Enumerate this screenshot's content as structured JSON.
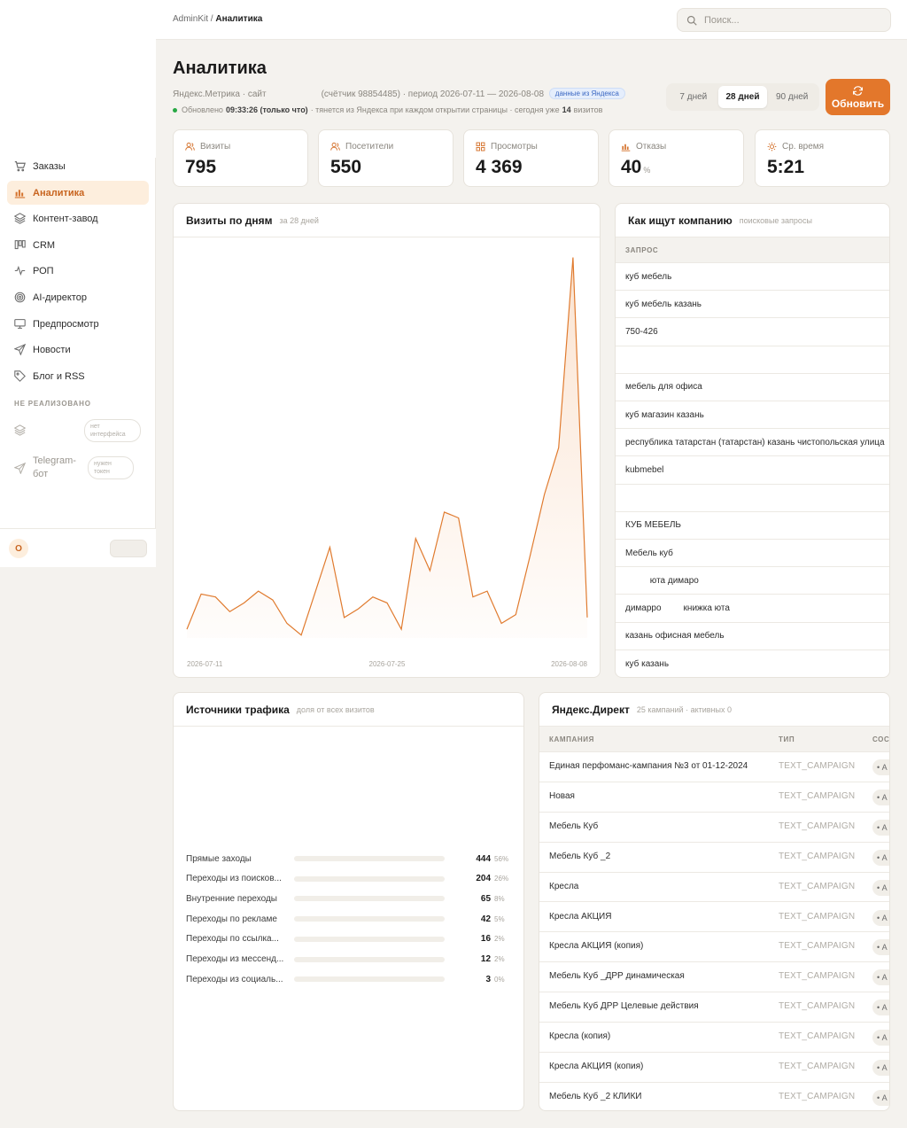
{
  "breadcrumb": {
    "root": "AdminKit",
    "separator": " / ",
    "current": "Аналитика"
  },
  "search": {
    "placeholder": "Поиск..."
  },
  "sidebar": {
    "items": [
      {
        "label": "Заказы",
        "icon": "cart-icon",
        "active": false
      },
      {
        "label": "Аналитика",
        "icon": "bar-chart-icon",
        "active": true
      },
      {
        "label": "Контент-завод",
        "icon": "layers-icon",
        "active": false
      },
      {
        "label": "CRM",
        "icon": "kanban-icon",
        "active": false
      },
      {
        "label": "РОП",
        "icon": "activity-icon",
        "active": false
      },
      {
        "label": "AI-директор",
        "icon": "target-icon",
        "active": false
      },
      {
        "label": "Предпросмотр",
        "icon": "monitor-icon",
        "active": false
      },
      {
        "label": "Новости",
        "icon": "send-icon",
        "active": false
      },
      {
        "label": "Блог и RSS",
        "icon": "tag-icon",
        "active": false
      }
    ],
    "section_label": "НЕ РЕАЛИЗОВАНО",
    "disabled": [
      {
        "label": "",
        "note": "нет интерфейса",
        "icon": "layers-icon"
      },
      {
        "label": "Telegram-бот",
        "note": "нужен токен",
        "icon": "send-icon"
      }
    ],
    "avatar_initial": "О"
  },
  "header": {
    "title": "Аналитика",
    "source": "Яндекс.Метрика · сайт",
    "counter": "(счётчик 98854485) · период 2026-07-11 — 2026-08-08",
    "badge": "данные из Яндекса",
    "updated_prefix": "Обновлено",
    "updated_time": "09:33:26 (только что)",
    "updated_suffix": "· тянется из Яндекса при каждом открытии страницы · сегодня уже",
    "today_visits": "14",
    "today_visits_unit": "визитов",
    "ranges": [
      "7 дней",
      "28 дней",
      "90 дней"
    ],
    "selected_range": "28 дней",
    "refresh_label": "Обновить"
  },
  "kpis": [
    {
      "label": "Визиты",
      "value": "795",
      "unit": "",
      "icon": "users-icon"
    },
    {
      "label": "Посетители",
      "value": "550",
      "unit": "",
      "icon": "users-icon"
    },
    {
      "label": "Просмотры",
      "value": "4 369",
      "unit": "",
      "icon": "grid-icon"
    },
    {
      "label": "Отказы",
      "value": "40",
      "unit": "%",
      "icon": "bar-chart-icon"
    },
    {
      "label": "Ср. время",
      "value": "5:21",
      "unit": "",
      "icon": "sun-icon"
    }
  ],
  "visits_card": {
    "title": "Визиты по дням",
    "subtitle": "за 28 дней"
  },
  "chart_data": {
    "type": "area",
    "title": "Визиты по дням",
    "x": [
      "2026-07-11",
      "2026-07-12",
      "2026-07-13",
      "2026-07-14",
      "2026-07-15",
      "2026-07-16",
      "2026-07-17",
      "2026-07-18",
      "2026-07-19",
      "2026-07-20",
      "2026-07-21",
      "2026-07-22",
      "2026-07-23",
      "2026-07-24",
      "2026-07-25",
      "2026-07-26",
      "2026-07-27",
      "2026-07-28",
      "2026-07-29",
      "2026-07-30",
      "2026-07-31",
      "2026-08-01",
      "2026-08-02",
      "2026-08-03",
      "2026-08-04",
      "2026-08-05",
      "2026-08-06",
      "2026-08-07",
      "2026-08-08"
    ],
    "values": [
      3,
      15,
      14,
      9,
      12,
      16,
      13,
      5,
      1,
      16,
      31,
      7,
      10,
      14,
      12,
      3,
      34,
      23,
      43,
      41,
      14,
      16,
      5,
      8,
      28,
      49,
      65,
      130,
      7
    ],
    "ylim": [
      0,
      135
    ],
    "x_tick_labels": [
      "2026-07-11",
      "2026-07-25",
      "2026-08-08"
    ],
    "grid": false,
    "color": "#e07b2f"
  },
  "queries_card": {
    "title": "Как ищут компанию",
    "subtitle": "поисковые запросы",
    "column": "ЗАПРОС",
    "rows": [
      "куб мебель",
      "куб мебель казань",
      "750-426",
      "",
      "мебель для офиса",
      "куб магазин казань",
      "республика татарстан (татарстан) казань чистопольская улица",
      "kubmebel",
      "",
      "КУБ МЕБЕЛЬ",
      "Мебель куб",
      "          юта димаро",
      "димарро         книжка юта",
      "казань офисная мебель",
      "куб казань"
    ]
  },
  "sources_card": {
    "title": "Источники трафика",
    "subtitle": "доля от всех визитов",
    "rows": [
      {
        "name": "Прямые заходы",
        "value": "444",
        "pct": "56%",
        "share": 56
      },
      {
        "name": "Переходы из поисков...",
        "value": "204",
        "pct": "26%",
        "share": 26
      },
      {
        "name": "Внутренние переходы",
        "value": "65",
        "pct": "8%",
        "share": 8
      },
      {
        "name": "Переходы по рекламе",
        "value": "42",
        "pct": "5%",
        "share": 5
      },
      {
        "name": "Переходы по ссылка...",
        "value": "16",
        "pct": "2%",
        "share": 2
      },
      {
        "name": "Переходы из мессенд...",
        "value": "12",
        "pct": "2%",
        "share": 2
      },
      {
        "name": "Переходы из социаль...",
        "value": "3",
        "pct": "0%",
        "share": 0
      }
    ]
  },
  "direct_card": {
    "title": "Яндекс.Директ",
    "subtitle": "25 кампаний · активных 0",
    "columns": [
      "КАМПАНИЯ",
      "ТИП",
      "СОСТ"
    ],
    "rows": [
      {
        "name": "Единая перфоманс-кампания №3 от 01-12-2024",
        "type": "TEXT_CAMPAIGN",
        "status": "• А"
      },
      {
        "name": "Новая",
        "type": "TEXT_CAMPAIGN",
        "status": "• А"
      },
      {
        "name": "Мебель Куб",
        "type": "TEXT_CAMPAIGN",
        "status": "• А"
      },
      {
        "name": "Мебель Куб _2",
        "type": "TEXT_CAMPAIGN",
        "status": "• А"
      },
      {
        "name": "Кресла",
        "type": "TEXT_CAMPAIGN",
        "status": "• А"
      },
      {
        "name": "Кресла АКЦИЯ",
        "type": "TEXT_CAMPAIGN",
        "status": "• А"
      },
      {
        "name": "Кресла АКЦИЯ (копия)",
        "type": "TEXT_CAMPAIGN",
        "status": "• А"
      },
      {
        "name": "Мебель Куб _ДРР динамическая",
        "type": "TEXT_CAMPAIGN",
        "status": "• А"
      },
      {
        "name": "Мебель Куб ДРР Целевые действия",
        "type": "TEXT_CAMPAIGN",
        "status": "• А"
      },
      {
        "name": "Кресла (копия)",
        "type": "TEXT_CAMPAIGN",
        "status": "• А"
      },
      {
        "name": "Кресла АКЦИЯ (копия)",
        "type": "TEXT_CAMPAIGN",
        "status": "• А"
      },
      {
        "name": "Мебель Куб _2 КЛИКИ",
        "type": "TEXT_CAMPAIGN",
        "status": "• А"
      }
    ]
  }
}
